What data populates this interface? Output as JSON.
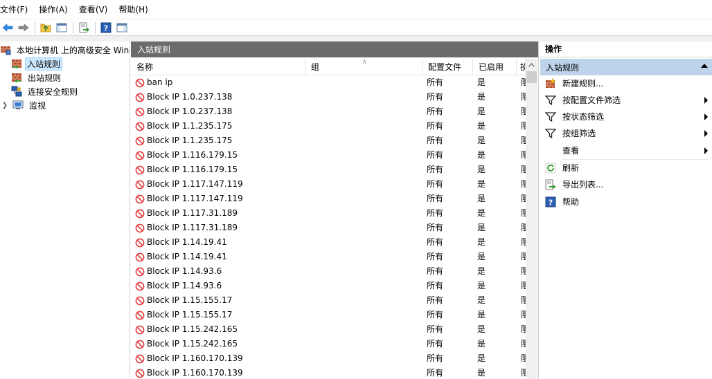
{
  "menu": [
    "文件(F)",
    "操作(A)",
    "查看(V)",
    "帮助(H)"
  ],
  "toolbar": {
    "icons": [
      "back-arrow-icon",
      "forward-arrow-icon",
      "folder-up-icon",
      "show-hide-console-tree-icon",
      "export-list-icon",
      "help-icon",
      "action-pane-icon"
    ]
  },
  "tree": {
    "root": "本地计算机 上的高级安全 Windows Defender 防火墙",
    "items": [
      {
        "label": "入站规则",
        "icon": "inbound-rules-icon",
        "selected": true
      },
      {
        "label": "出站规则",
        "icon": "outbound-rules-icon",
        "selected": false
      },
      {
        "label": "连接安全规则",
        "icon": "connection-security-icon",
        "selected": false
      },
      {
        "label": "监视",
        "icon": "monitor-icon",
        "selected": false
      }
    ]
  },
  "middle": {
    "header": "入站规则",
    "columns": {
      "name": "名称",
      "group": "组",
      "profile": "配置文件",
      "enabled": "已启用",
      "action": "操"
    },
    "rows": [
      {
        "name": "ban ip",
        "group": "",
        "profile": "所有",
        "enabled": "是",
        "action": "阻"
      },
      {
        "name": "Block IP 1.0.237.138",
        "group": "",
        "profile": "所有",
        "enabled": "是",
        "action": "阻"
      },
      {
        "name": "Block IP 1.0.237.138",
        "group": "",
        "profile": "所有",
        "enabled": "是",
        "action": "阻"
      },
      {
        "name": "Block IP 1.1.235.175",
        "group": "",
        "profile": "所有",
        "enabled": "是",
        "action": "阻"
      },
      {
        "name": "Block IP 1.1.235.175",
        "group": "",
        "profile": "所有",
        "enabled": "是",
        "action": "阻"
      },
      {
        "name": "Block IP 1.116.179.15",
        "group": "",
        "profile": "所有",
        "enabled": "是",
        "action": "阻"
      },
      {
        "name": "Block IP 1.116.179.15",
        "group": "",
        "profile": "所有",
        "enabled": "是",
        "action": "阻"
      },
      {
        "name": "Block IP 1.117.147.119",
        "group": "",
        "profile": "所有",
        "enabled": "是",
        "action": "阻"
      },
      {
        "name": "Block IP 1.117.147.119",
        "group": "",
        "profile": "所有",
        "enabled": "是",
        "action": "阻"
      },
      {
        "name": "Block IP 1.117.31.189",
        "group": "",
        "profile": "所有",
        "enabled": "是",
        "action": "阻"
      },
      {
        "name": "Block IP 1.117.31.189",
        "group": "",
        "profile": "所有",
        "enabled": "是",
        "action": "阻"
      },
      {
        "name": "Block IP 1.14.19.41",
        "group": "",
        "profile": "所有",
        "enabled": "是",
        "action": "阻"
      },
      {
        "name": "Block IP 1.14.19.41",
        "group": "",
        "profile": "所有",
        "enabled": "是",
        "action": "阻"
      },
      {
        "name": "Block IP 1.14.93.6",
        "group": "",
        "profile": "所有",
        "enabled": "是",
        "action": "阻"
      },
      {
        "name": "Block IP 1.14.93.6",
        "group": "",
        "profile": "所有",
        "enabled": "是",
        "action": "阻"
      },
      {
        "name": "Block IP 1.15.155.17",
        "group": "",
        "profile": "所有",
        "enabled": "是",
        "action": "阻"
      },
      {
        "name": "Block IP 1.15.155.17",
        "group": "",
        "profile": "所有",
        "enabled": "是",
        "action": "阻"
      },
      {
        "name": "Block IP 1.15.242.165",
        "group": "",
        "profile": "所有",
        "enabled": "是",
        "action": "阻"
      },
      {
        "name": "Block IP 1.15.242.165",
        "group": "",
        "profile": "所有",
        "enabled": "是",
        "action": "阻"
      },
      {
        "name": "Block IP 1.160.170.139",
        "group": "",
        "profile": "所有",
        "enabled": "是",
        "action": "阻"
      },
      {
        "name": "Block IP 1.160.170.139",
        "group": "",
        "profile": "所有",
        "enabled": "是",
        "action": "阻"
      }
    ]
  },
  "actions": {
    "title": "操作",
    "section": "入站规则",
    "items": [
      {
        "label": "新建规则...",
        "icon": "new-rule-icon",
        "submenu": false
      },
      {
        "label": "按配置文件筛选",
        "icon": "filter-icon",
        "submenu": true
      },
      {
        "label": "按状态筛选",
        "icon": "filter-icon",
        "submenu": true
      },
      {
        "label": "按组筛选",
        "icon": "filter-icon",
        "submenu": true
      },
      {
        "label": "查看",
        "icon": "",
        "submenu": true
      },
      {
        "label": "刷新",
        "icon": "refresh-icon",
        "submenu": false
      },
      {
        "label": "导出列表...",
        "icon": "export-list-icon",
        "submenu": false
      },
      {
        "label": "帮助",
        "icon": "help-icon",
        "submenu": false
      }
    ]
  },
  "colors": {
    "header_bar": "#6b6b6b",
    "section_highlight": "#bcd3ea",
    "selection": "#cce8ff",
    "block_icon": "#e23c3c"
  }
}
